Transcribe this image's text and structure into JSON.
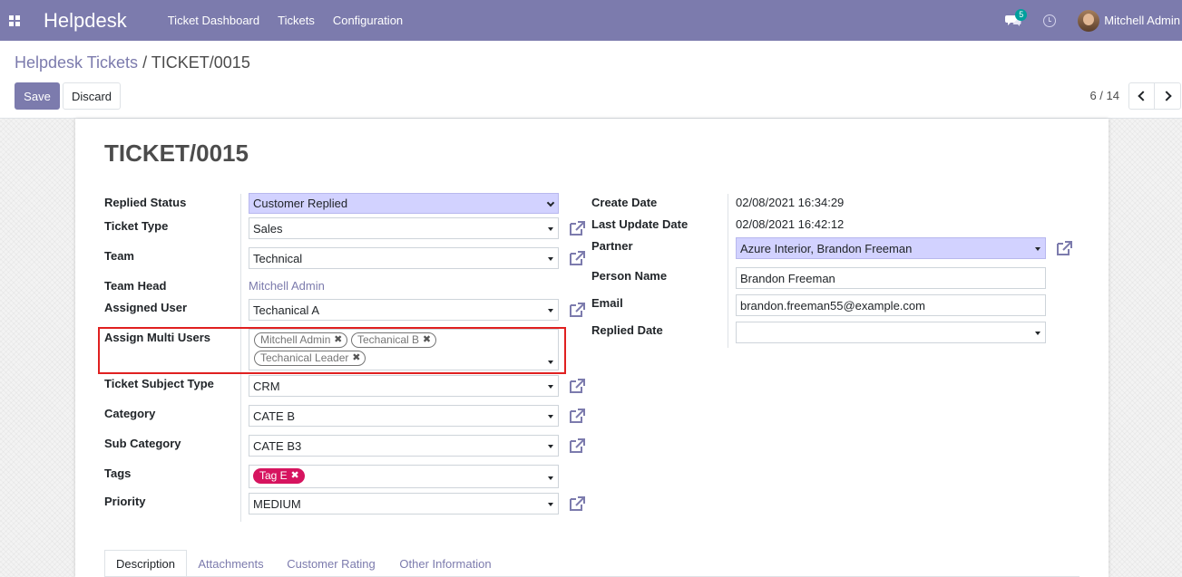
{
  "navbar": {
    "brand": "Helpdesk",
    "menu": [
      "Ticket Dashboard",
      "Tickets",
      "Configuration"
    ],
    "chat_badge": "5",
    "user_name": "Mitchell Admin",
    "colors": {
      "navbar_bg": "#7c7bad",
      "badge_bg": "#00a09d"
    },
    "icons": [
      "apps-grid-icon",
      "chat-icon",
      "clock-icon"
    ]
  },
  "breadcrumb": {
    "parent": "Helpdesk Tickets",
    "separator": "/",
    "current": "TICKET/0015"
  },
  "buttons": {
    "save": "Save",
    "discard": "Discard"
  },
  "pager": {
    "value": "6 / 14"
  },
  "form": {
    "title": "TICKET/0015",
    "left": {
      "replied_status": {
        "label": "Replied Status",
        "value": "Customer Replied"
      },
      "ticket_type": {
        "label": "Ticket Type",
        "value": "Sales"
      },
      "team": {
        "label": "Team",
        "value": "Technical"
      },
      "team_head": {
        "label": "Team Head",
        "value": "Mitchell Admin"
      },
      "assigned_user": {
        "label": "Assigned User",
        "value": "Techanical A"
      },
      "assign_multi_users": {
        "label": "Assign Multi Users",
        "tags": [
          "Mitchell Admin",
          "Techanical B",
          "Techanical Leader"
        ]
      },
      "ticket_subject_type": {
        "label": "Ticket Subject Type",
        "value": "CRM"
      },
      "category": {
        "label": "Category",
        "value": "CATE B"
      },
      "sub_category": {
        "label": "Sub Category",
        "value": "CATE B3"
      },
      "tags": {
        "label": "Tags",
        "tags": [
          "Tag E"
        ],
        "tag_color": "#d6145f"
      },
      "priority": {
        "label": "Priority",
        "value": "MEDIUM"
      }
    },
    "right": {
      "create_date": {
        "label": "Create Date",
        "value": "02/08/2021 16:34:29"
      },
      "last_update_date": {
        "label": "Last Update Date",
        "value": "02/08/2021 16:42:12"
      },
      "partner": {
        "label": "Partner",
        "value": "Azure Interior, Brandon Freeman"
      },
      "person_name": {
        "label": "Person Name",
        "value": "Brandon Freeman"
      },
      "email": {
        "label": "Email",
        "value": "brandon.freeman55@example.com"
      },
      "replied_date": {
        "label": "Replied Date",
        "value": ""
      }
    }
  },
  "tabs": [
    "Description",
    "Attachments",
    "Customer Rating",
    "Other Information"
  ],
  "tag_remove_glyph": "✖"
}
